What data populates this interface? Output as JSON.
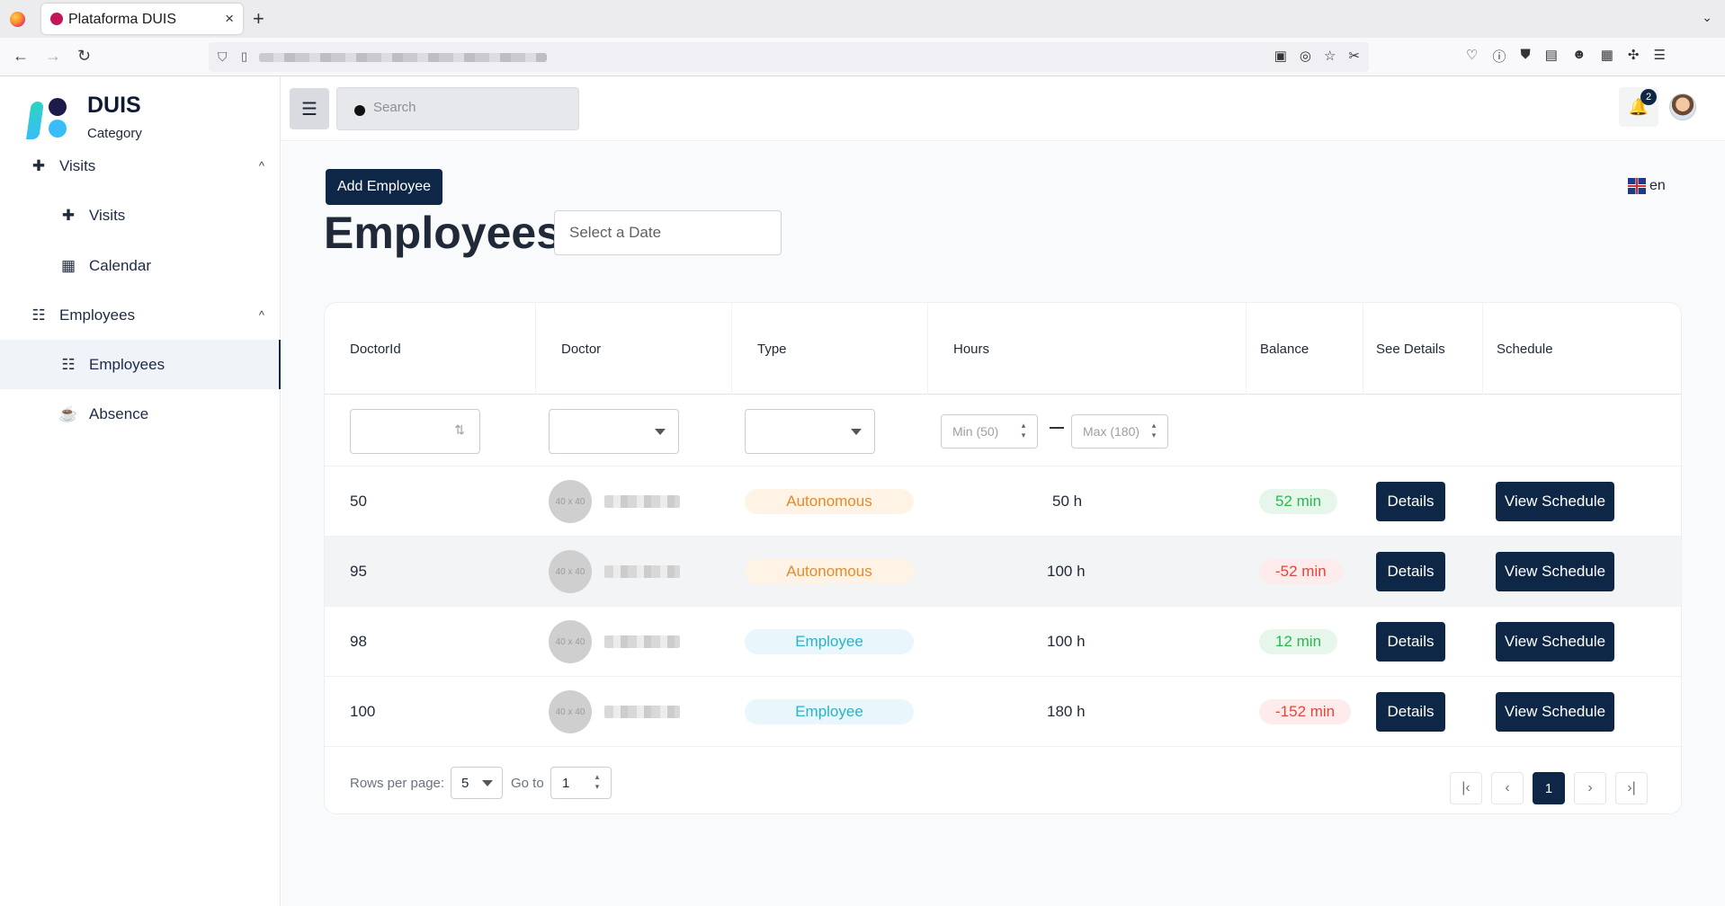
{
  "browser": {
    "tab_title": "Plataforma DUIS",
    "tab_close": "×",
    "new_tab": "+",
    "tab_list": "⌄",
    "back": "←",
    "forward": "→",
    "reload": "↻"
  },
  "sidebar": {
    "brand": "DUIS",
    "brand_sub": "Category",
    "items": [
      {
        "label": "Visits",
        "icon": "medical-bag-icon",
        "glyph": "✚",
        "expanded": true
      },
      {
        "label": "Visits",
        "icon": "medical-bag-icon",
        "glyph": "✚"
      },
      {
        "label": "Calendar",
        "icon": "calendar-icon",
        "glyph": "▦"
      },
      {
        "label": "Employees",
        "icon": "users-icon",
        "glyph": "☷",
        "expanded": true
      },
      {
        "label": "Employees",
        "icon": "users-icon",
        "glyph": "☷",
        "active": true
      },
      {
        "label": "Absence",
        "icon": "coffee-cup-icon",
        "glyph": "☕"
      }
    ],
    "chevron": "^"
  },
  "topbar": {
    "menu_toggle_glyph": "☰",
    "search_placeholder": "Search",
    "notifications_count": "2",
    "bell_glyph": "🔔"
  },
  "main": {
    "add_button": "Add Employee",
    "language": "en",
    "title": "Employees",
    "date_placeholder": "Select a Date"
  },
  "table": {
    "columns": [
      "DoctorId",
      "Doctor",
      "Type",
      "Hours",
      "Balance",
      "See Details",
      "Schedule"
    ],
    "filters": {
      "min_placeholder": "Min (50)",
      "max_placeholder": "Max (180)",
      "sort_glyph": "⇅",
      "spin_glyph_up": "▴",
      "spin_glyph_down": "▾"
    },
    "avatar_placeholder": "40 x 40",
    "rows": [
      {
        "id": "50",
        "type": "Autonomous",
        "hours": "50 h",
        "balance": "52 min",
        "balance_status": "positive",
        "details": "Details",
        "schedule": "View Schedule"
      },
      {
        "id": "95",
        "type": "Autonomous",
        "hours": "100 h",
        "balance": "-52 min",
        "balance_status": "negative",
        "details": "Details",
        "schedule": "View Schedule"
      },
      {
        "id": "98",
        "type": "Employee",
        "hours": "100 h",
        "balance": "12 min",
        "balance_status": "positive",
        "details": "Details",
        "schedule": "View Schedule"
      },
      {
        "id": "100",
        "type": "Employee",
        "hours": "180 h",
        "balance": "-152 min",
        "balance_status": "negative",
        "details": "Details",
        "schedule": "View Schedule"
      }
    ]
  },
  "pagination": {
    "rows_per_page_label": "Rows per page:",
    "rows_per_page_value": "5",
    "goto_label": "Go to",
    "goto_value": "1",
    "first": "|‹",
    "prev": "‹",
    "current": "1",
    "next": "›",
    "last": "›|"
  },
  "colors": {
    "primary": "#0f2747",
    "autonomous": "#e08c2e",
    "employee": "#29b3c8",
    "positive": "#2fb452",
    "negative": "#e0473e"
  }
}
